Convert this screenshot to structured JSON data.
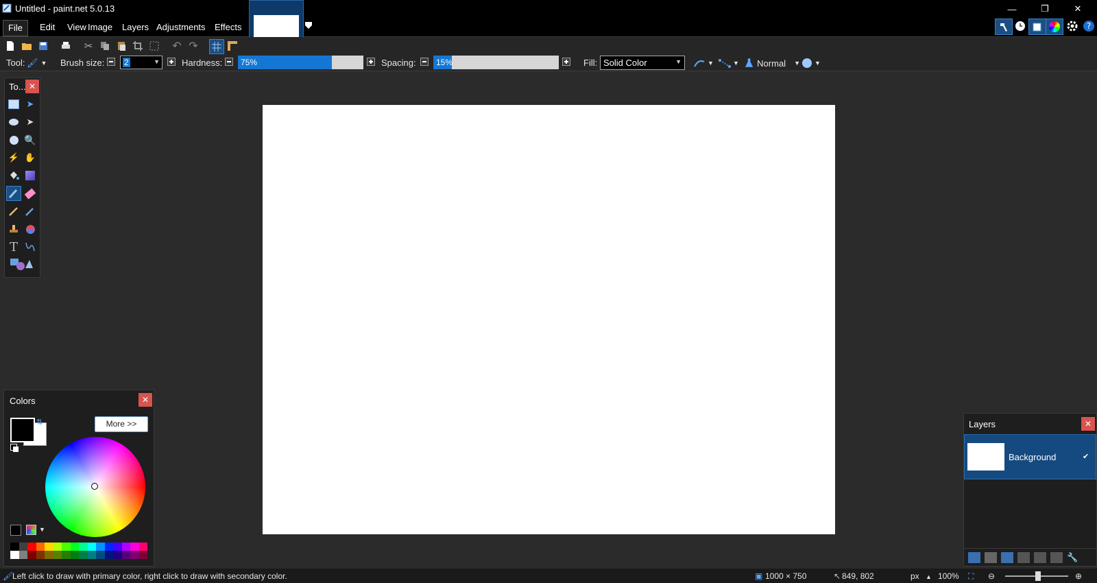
{
  "window": {
    "title": "Untitled - paint.net 5.0.13"
  },
  "menu": [
    "File",
    "Edit",
    "View",
    "Image",
    "Layers",
    "Adjustments",
    "Effects"
  ],
  "toolbar": {
    "tool_label": "Tool:",
    "brush_size_label": "Brush size:",
    "brush_size_value": "2",
    "hardness_label": "Hardness:",
    "hardness_value": "75%",
    "hardness_fraction": 0.75,
    "spacing_label": "Spacing:",
    "spacing_value": "15%",
    "spacing_fraction": 0.15,
    "fill_label": "Fill:",
    "fill_value": "Solid Color",
    "blend_mode": "Normal"
  },
  "tools_panel": {
    "title": "To..."
  },
  "colors_panel": {
    "title": "Colors",
    "more_button": "More >>",
    "primary_color": "#000000",
    "secondary_color": "#ffffff",
    "palette_top": [
      "#000000",
      "#404040",
      "#ff0000",
      "#ff6a00",
      "#ffd800",
      "#b6ff00",
      "#4cff00",
      "#00ff21",
      "#00ff90",
      "#00ffff",
      "#0094ff",
      "#0026ff",
      "#4800ff",
      "#b200ff",
      "#ff00dc",
      "#ff006e"
    ],
    "palette_bottom": [
      "#ffffff",
      "#808080",
      "#7f0000",
      "#7f3300",
      "#7f6a00",
      "#5b7f00",
      "#267f00",
      "#007f0e",
      "#007f46",
      "#007f7f",
      "#004a7f",
      "#00137f",
      "#21007f",
      "#57007f",
      "#7f006e",
      "#7f0037"
    ]
  },
  "layers_panel": {
    "title": "Layers",
    "layer_name": "Background"
  },
  "status": {
    "hint": "Left click to draw with primary color, right click to draw with secondary color.",
    "image_size": "1000 × 750",
    "cursor_pos": "849, 802",
    "units": "px",
    "zoom": "100%"
  },
  "icons": {
    "minimize": "—",
    "restore": "❐",
    "close": "✕",
    "panel_close": "✕"
  }
}
